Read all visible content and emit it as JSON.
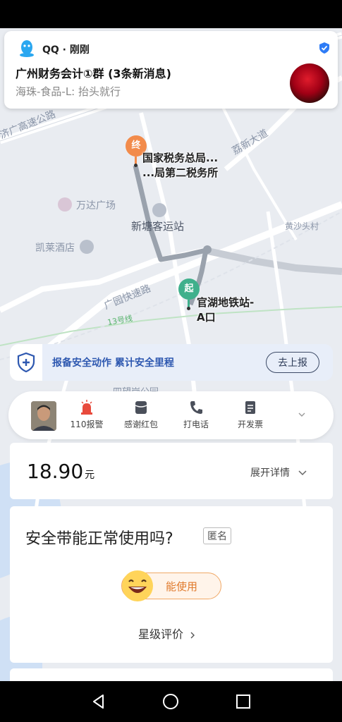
{
  "notification": {
    "app": "QQ · 刚刚",
    "title": "广州财务会计①群 (3条新消息)",
    "body": "海珠-食品-L: 抬头就行"
  },
  "map": {
    "road_labels": [
      "济广高速公路",
      "荔新大道",
      "广园快速路",
      "13号线"
    ],
    "poi_labels": [
      "万达广场",
      "新塘客运站",
      "凯莱酒店",
      "黄沙头村",
      "四望岗公园"
    ],
    "destination": {
      "marker": "终",
      "name_line1": "国家税务总局...",
      "name_line2": "...局第二税务所"
    },
    "origin": {
      "marker": "起",
      "name_line1": "官湖地铁站-",
      "name_line2": "A口"
    },
    "route_color": "#9aa2ad"
  },
  "safety_banner": {
    "text": "报备安全动作 累计安全里程",
    "button": "去上报"
  },
  "driver_actions": [
    {
      "icon": "alarm-icon",
      "label": "110报警"
    },
    {
      "icon": "red-packet-icon",
      "label": "感谢红包"
    },
    {
      "icon": "phone-icon",
      "label": "打电话"
    },
    {
      "icon": "invoice-icon",
      "label": "开发票"
    }
  ],
  "fare": {
    "amount": "18.90",
    "unit": "元",
    "detail_link": "展开详情"
  },
  "rating": {
    "question": "安全带能正常使用吗?",
    "anonymous_tag": "匿名",
    "answer_button": "能使用",
    "star_link": "星级评价"
  },
  "colors": {
    "accent_blue": "#2e58b0",
    "accent_orange": "#e07a2c",
    "start_green": "#3fb08c",
    "end_orange": "#f28b4b"
  }
}
